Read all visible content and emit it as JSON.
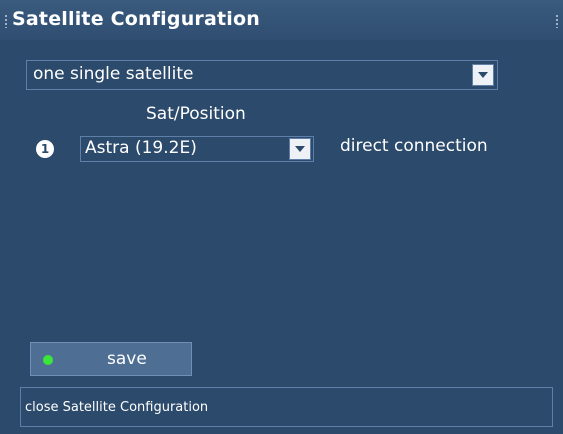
{
  "window": {
    "title": "Satellite Configuration"
  },
  "config": {
    "mode": {
      "selected": "one single satellite",
      "icon": "chevron-down-icon"
    },
    "column_header": "Sat/Position",
    "slots": [
      {
        "number": "1",
        "satellite": "Astra (19.2E)",
        "connection": "direct connection"
      }
    ]
  },
  "actions": {
    "save_label": "save",
    "save_led_color": "#3be63b"
  },
  "status_bar": {
    "text": "close Satellite Configuration"
  }
}
